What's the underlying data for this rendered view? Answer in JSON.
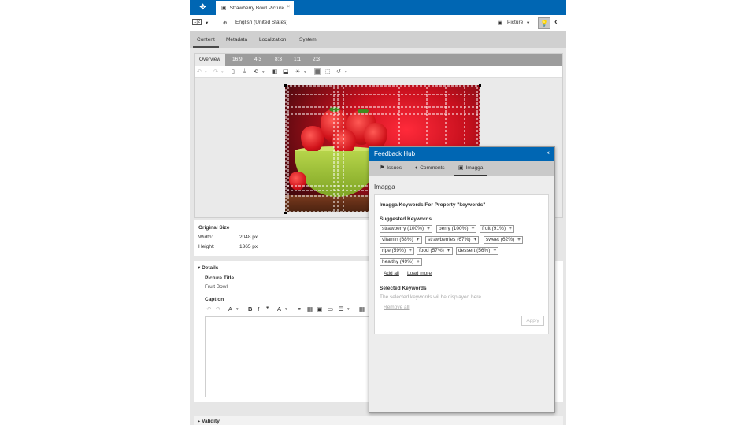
{
  "topbar": {
    "home_icon": "compass-icon",
    "doc_tab": {
      "icon": "picture-icon",
      "label": "Strawberry Bowl Picture",
      "close": "×"
    }
  },
  "toolbar": {
    "layout_icon": "1|2",
    "layout_caret": "▾",
    "language_icon": "globe-icon",
    "language": "English (United States)",
    "type_icon": "picture-icon",
    "type": "Picture",
    "type_caret": "▾",
    "idea_icon": "lightbulb-icon",
    "back_icon": "chevron-left-icon"
  },
  "tabs": [
    "Content",
    "Metadata",
    "Localization",
    "System"
  ],
  "crop_tabs": [
    "Overview",
    "16:9",
    "4:3",
    "8:3",
    "1:1",
    "2:3"
  ],
  "editor_tools": {
    "undo": "↶",
    "redo": "↷",
    "caret": "▾",
    "trash": "🗑",
    "download": "⤓",
    "rotate": "⟲",
    "flip_h": "◧",
    "flip_v": "⬓",
    "brightness": "☀",
    "grid": "▦",
    "crop": "⬚",
    "reset": "↺"
  },
  "original_size": {
    "title": "Original Size",
    "width_label": "Width:",
    "width_value": "2048 px",
    "height_label": "Height:",
    "height_value": "1365 px"
  },
  "details": {
    "header": "Details",
    "picture_title_label": "Picture Title",
    "picture_title_value": "Fruit Bowl",
    "caption_label": "Caption"
  },
  "rte_tools": {
    "undo": "↶",
    "redo": "↷",
    "font": "A",
    "bold": "B",
    "italic": "I",
    "quote": "❞",
    "color": "A",
    "caret": "▾",
    "link": "🔗",
    "table": "▦",
    "image": "▣",
    "media": "▭",
    "list": "☰",
    "more": "▦"
  },
  "validity": {
    "header": "Validity"
  },
  "hub": {
    "title": "Feedback Hub",
    "close": "×",
    "tabs": [
      {
        "icon": "flag-icon",
        "glyph": "⚑",
        "label": "Issues"
      },
      {
        "icon": "comment-icon",
        "glyph": "💬",
        "label": "Comments"
      },
      {
        "icon": "imagga-icon",
        "glyph": "▣",
        "label": "Imagga"
      }
    ],
    "section": "Imagga",
    "card_title": "Imagga Keywords For Property \"keywords\"",
    "suggested_label": "Suggested Keywords",
    "keywords": [
      "strawberry (100%)",
      "berry (100%)",
      "fruit (91%)",
      "vitamin (68%)",
      "strawberries (67%)",
      "sweet (62%)",
      "ripe (59%)",
      "food (57%)",
      "dessert (56%)",
      "healthy (49%)"
    ],
    "chip_plus": "+",
    "add_all": "Add all",
    "load_more": "Load more",
    "selected_label": "Selected Keywords",
    "selected_hint": "The selected keywords wil be displayed here.",
    "remove_all": "Remove all",
    "apply": "Apply"
  }
}
